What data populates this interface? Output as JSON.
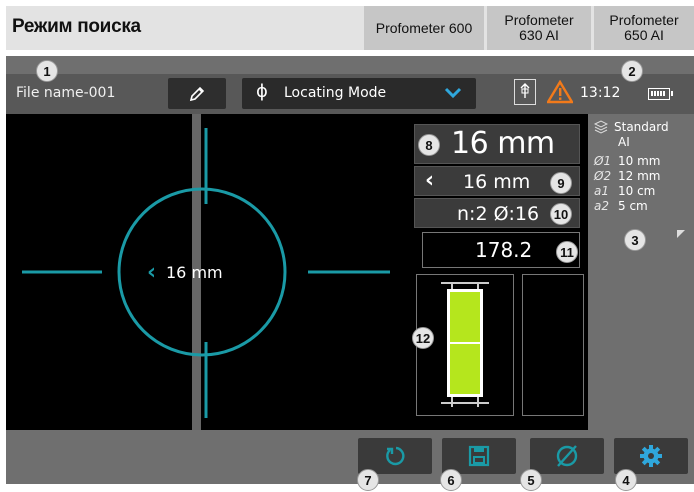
{
  "header": {
    "title": "Режим поиска",
    "tabs": [
      {
        "line1": "Profometer 600",
        "line2": ""
      },
      {
        "line1": "Profometer",
        "line2": "630 AI"
      },
      {
        "line1": "Profometer",
        "line2": "650 AI"
      }
    ]
  },
  "topbar": {
    "file_name": "File name-001",
    "edit_icon": "pencil-icon",
    "mode_symbol": "ϕ",
    "mode_label": "Locating Mode",
    "time": "13:12",
    "gps_icon": "gps-icon",
    "warning_icon": "warning-icon",
    "warning_color": "#f27a1a",
    "battery_icon": "battery-icon"
  },
  "scan": {
    "cover_label": "16 mm",
    "arrow": "‹",
    "crosshair_color": "#1a9aa6"
  },
  "readings": {
    "main_value": "16 mm",
    "secondary_arrow": "‹",
    "secondary_value": "16 mm",
    "count_diameter": "n:2  Ø:16",
    "numeric_value": "178.2",
    "level_fill_color": "#b5e61d"
  },
  "info": {
    "standard_line1": "Standard",
    "standard_line2": "AI",
    "rows": [
      {
        "key": "Ø1",
        "value": "10 mm"
      },
      {
        "key": "Ø2",
        "value": "12 mm"
      },
      {
        "key": "a1",
        "value": "10 cm"
      },
      {
        "key": "a2",
        "value": "5 cm"
      }
    ]
  },
  "bottom": {
    "buttons": [
      {
        "name": "reset",
        "icon": "reset-icon"
      },
      {
        "name": "save",
        "icon": "save-icon"
      },
      {
        "name": "diameter",
        "icon": "diameter-icon"
      },
      {
        "name": "settings",
        "icon": "gear-icon"
      }
    ],
    "accent": "#1a9aa6"
  },
  "callouts": [
    "1",
    "2",
    "3",
    "4",
    "5",
    "6",
    "7",
    "8",
    "9",
    "10",
    "11",
    "12"
  ]
}
